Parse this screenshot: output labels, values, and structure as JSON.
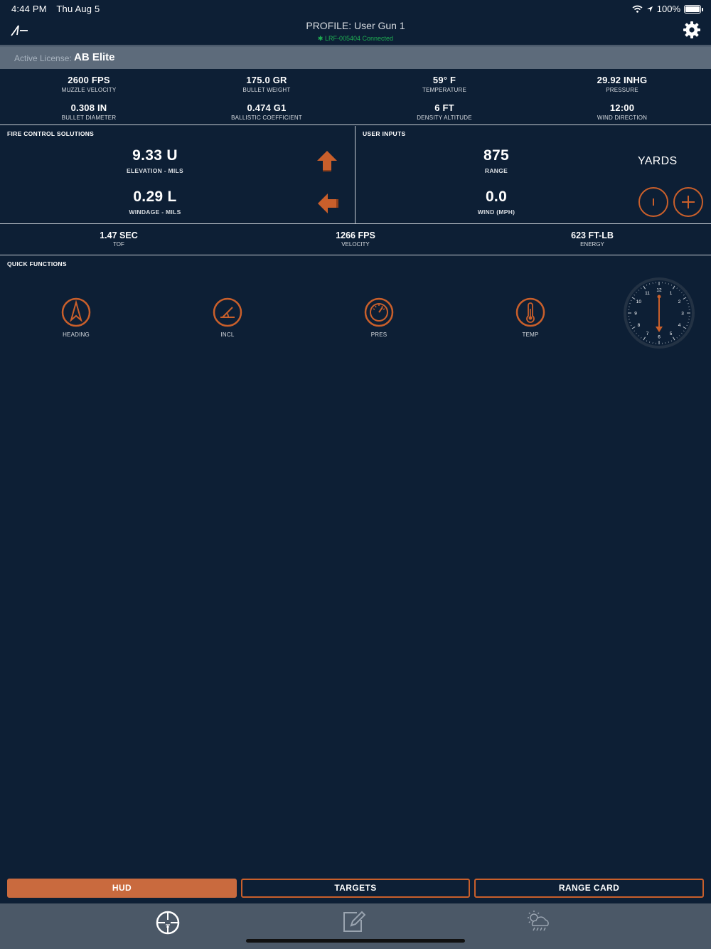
{
  "status_bar": {
    "time": "4:44 PM",
    "date": "Thu Aug 5",
    "battery": "100%"
  },
  "header": {
    "title": "PROFILE: User Gun 1",
    "connection": "LRF-005404 Connected"
  },
  "license": {
    "label": "Active License:",
    "value": "AB Elite"
  },
  "stats": [
    {
      "value": "2600 FPS",
      "label": "MUZZLE VELOCITY"
    },
    {
      "value": "175.0 GR",
      "label": "BULLET WEIGHT"
    },
    {
      "value": "59° F",
      "label": "TEMPERATURE"
    },
    {
      "value": "29.92 INHG",
      "label": "PRESSURE"
    },
    {
      "value": "0.308 IN",
      "label": "BULLET DIAMETER"
    },
    {
      "value": "0.474 G1",
      "label": "BALLISTIC COEFFICIENT"
    },
    {
      "value": "6 FT",
      "label": "DENSITY ALTITUDE"
    },
    {
      "value": "12:00",
      "label": "WIND DIRECTION"
    }
  ],
  "fire_control": {
    "label": "FIRE CONTROL SOLUTIONS",
    "elevation": {
      "value": "9.33 U",
      "label": "ELEVATION - MILS"
    },
    "windage": {
      "value": "0.29 L",
      "label": "WINDAGE - MILS"
    }
  },
  "user_inputs": {
    "label": "USER INPUTS",
    "range": {
      "value": "875",
      "label": "RANGE"
    },
    "wind": {
      "value": "0.0",
      "label": "WIND (MPH)"
    },
    "unit": "YARDS"
  },
  "results": [
    {
      "value": "1.47 SEC",
      "label": "TOF"
    },
    {
      "value": "1266 FPS",
      "label": "VELOCITY"
    },
    {
      "value": "623 FT-LB",
      "label": "ENERGY"
    }
  ],
  "quick_functions": {
    "label": "QUICK FUNCTIONS",
    "items": [
      {
        "label": "HEADING",
        "icon": "compass-icon"
      },
      {
        "label": "INCL",
        "icon": "inclination-icon"
      },
      {
        "label": "PRES",
        "icon": "gauge-icon"
      },
      {
        "label": "TEMP",
        "icon": "thermometer-icon"
      }
    ],
    "wind_clock": {
      "numbers": [
        "12",
        "1",
        "2",
        "3",
        "4",
        "5",
        "6",
        "7",
        "8",
        "9",
        "10",
        "11"
      ],
      "direction": "12:00"
    }
  },
  "tabs": [
    "HUD",
    "TARGETS",
    "RANGE CARD"
  ],
  "active_tab": "HUD",
  "colors": {
    "background": "#0d1f35",
    "accent": "#c95f2b",
    "connected": "#1fae53",
    "license_bar": "#5d6b7b",
    "bottom_nav": "#4b5867"
  }
}
